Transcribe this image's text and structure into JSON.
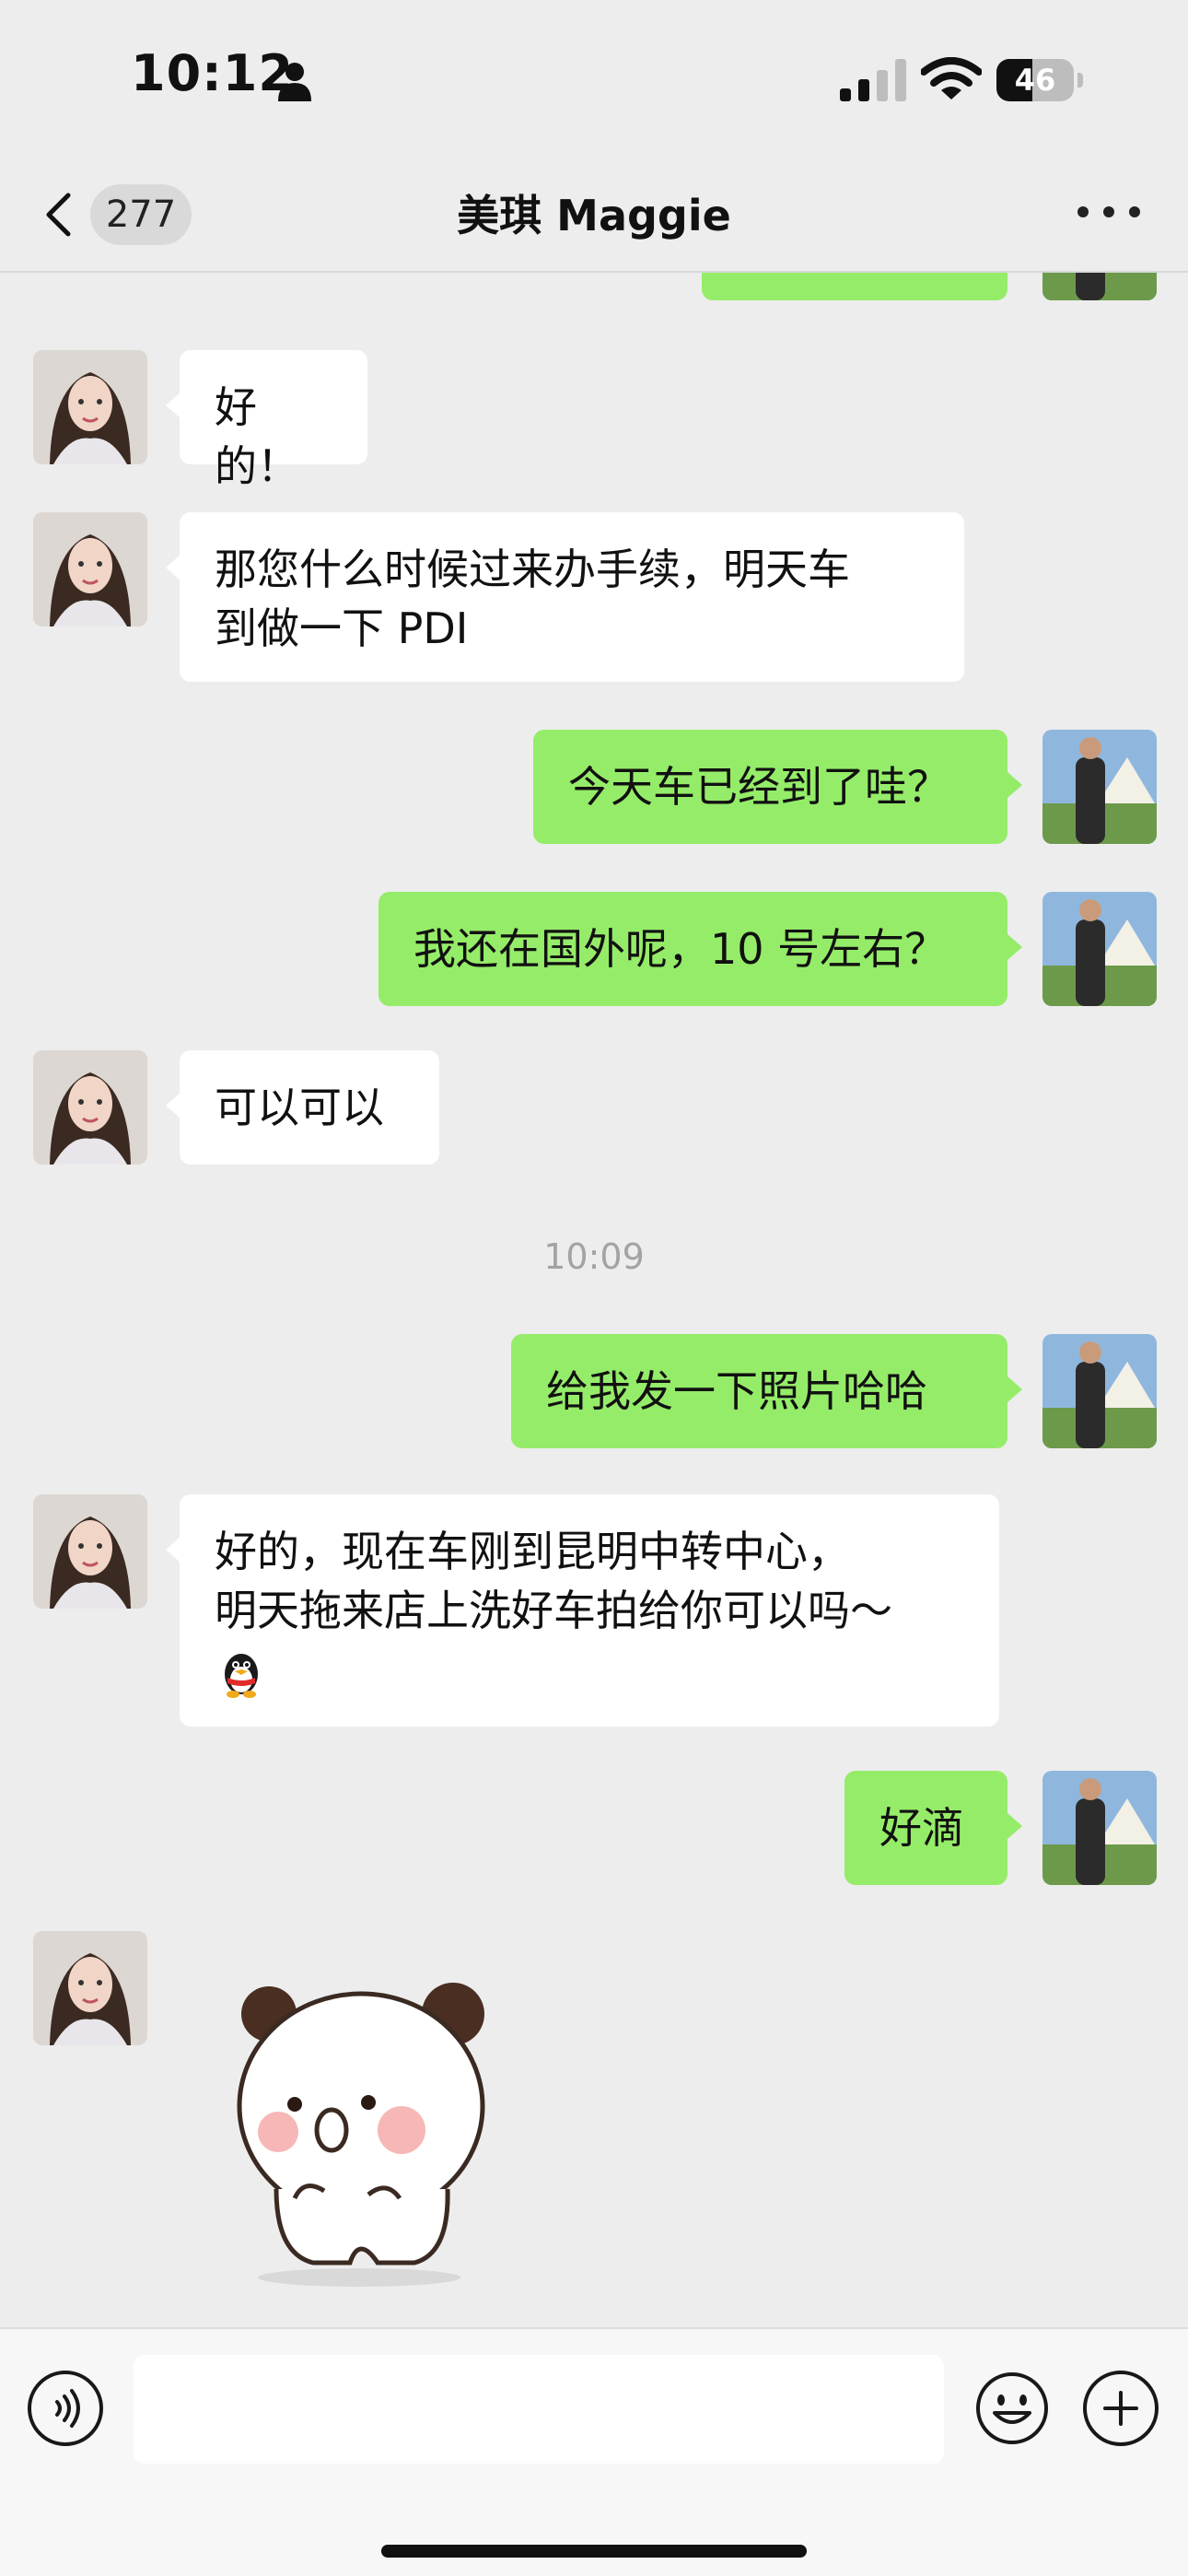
{
  "status_bar": {
    "time": "10:12",
    "battery_level": 46,
    "battery_text": "46"
  },
  "nav": {
    "unread_count": "277",
    "title": "美琪 Maggie"
  },
  "messages": [
    {
      "side": "in",
      "text": "好的！"
    },
    {
      "side": "in",
      "lines": [
        "那您什么时候过来办手续，明天车",
        "到做一下 PDI"
      ]
    },
    {
      "side": "out",
      "text": "今天车已经到了哇？"
    },
    {
      "side": "out",
      "text": "我还在国外呢，10 号左右？"
    },
    {
      "side": "in",
      "text": "可以可以"
    },
    {
      "timestamp": "10:09"
    },
    {
      "side": "out",
      "text": "给我发一下照片哈哈"
    },
    {
      "side": "in",
      "lines": [
        "好的，现在车刚到昆明中转中心，",
        "明天拖来店上洗好车拍给你可以吗～"
      ],
      "emoji": "penguin-emoji"
    },
    {
      "side": "out",
      "text": "好滴"
    },
    {
      "side": "in",
      "sticker": "panda-sticker"
    }
  ],
  "colors": {
    "background": "#ededed",
    "bubble_in": "#ffffff",
    "bubble_out": "#95ec69",
    "timestamp": "#a3a3a3"
  },
  "input": {
    "value": "",
    "placeholder": ""
  }
}
